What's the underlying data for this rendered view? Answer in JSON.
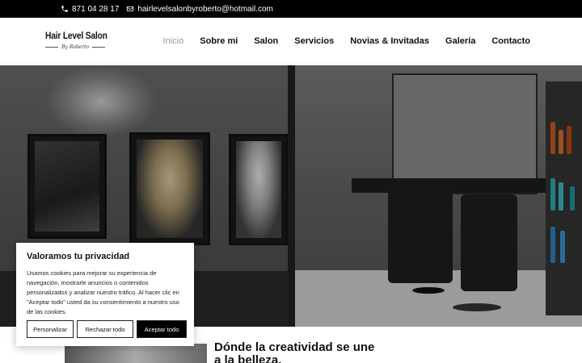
{
  "topbar": {
    "phone": "871 04 28 17",
    "email": "hairlevelsalonbyroberto@hotmail.com",
    "phone_icon": "phone-icon",
    "email_icon": "envelope-icon"
  },
  "logo": {
    "brand": "Hair Level Salon",
    "signature": "By Roberto"
  },
  "nav": {
    "items": [
      {
        "label": "Inicio",
        "active": true
      },
      {
        "label": "Sobre mi"
      },
      {
        "label": "Salon"
      },
      {
        "label": "Servicios"
      },
      {
        "label": "Novias & Invitadas"
      },
      {
        "label": "Galería"
      },
      {
        "label": "Contacto"
      }
    ]
  },
  "hero": {
    "description": "salon interior"
  },
  "section": {
    "headline": "Dónde la creatividad se une a la belleza."
  },
  "cookie": {
    "title": "Valoramos tu privacidad",
    "text": "Usamos cookies para mejorar su experiencia de navegación, mostrarle anuncios o contenidos personalizados y analizar nuestro tráfico. Al hacer clic en \"Aceptar todo\" usted da su consentimiento a nuestro uso de las cookies.",
    "customize_label": "Personalizar",
    "reject_label": "Rechazar todo",
    "accept_label": "Aceptar todo"
  }
}
